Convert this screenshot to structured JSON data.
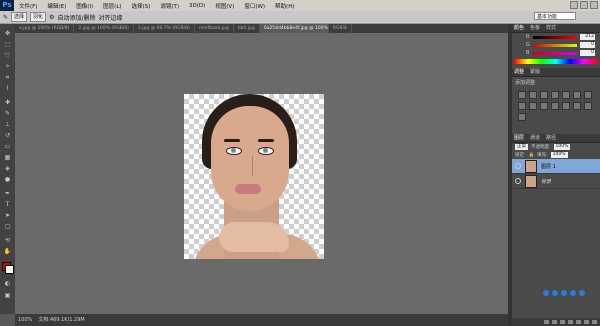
{
  "app": {
    "logo": "Ps",
    "workspace": "基本功能"
  },
  "menu": [
    "文件(F)",
    "编辑(E)",
    "图像(I)",
    "图层(L)",
    "选择(S)",
    "滤镜(T)",
    "3D(D)",
    "视图(V)",
    "窗口(W)",
    "帮助(H)"
  ],
  "options": {
    "mode": "选择",
    "feather": "羽化",
    "auto": "自动添加/删除",
    "align": "对齐边缘"
  },
  "tabs": [
    {
      "label": "a.jpg @ 100% (RGB/8)"
    },
    {
      "label": "2.jpg @ 100% (RGB/8)"
    },
    {
      "label": "3.jpg @ 66.7% (RGB/8)"
    },
    {
      "label": "mmfbaab.jpg"
    },
    {
      "label": "bb5.jpg"
    },
    {
      "label": "0a254d4bb8e4f.jpg @ 100% (图层 1, RGB/8)"
    },
    {
      "label": "RGB/8"
    }
  ],
  "colors": {
    "foreground": "#e00000",
    "background": "#ffffff",
    "layer_selected": "#7fa7d8"
  },
  "color_panel": {
    "tabs": [
      "颜色",
      "色板",
      "样式"
    ],
    "sliders": [
      {
        "label": "R",
        "value": "212"
      },
      {
        "label": "G",
        "value": "0"
      },
      {
        "label": "B",
        "value": "0"
      }
    ]
  },
  "adjust_panel": {
    "tabs": [
      "调整",
      "蒙版"
    ],
    "title": "添加调整"
  },
  "layers_panel": {
    "tabs": [
      "图层",
      "通道",
      "路径"
    ],
    "blend": "正常",
    "opacity_label": "不透明度:",
    "opacity": "100%",
    "lock_label": "锁定:",
    "fill_label": "填充:",
    "fill": "100%",
    "layers": [
      {
        "name": "图层 1",
        "selected": true
      },
      {
        "name": "背景",
        "selected": false
      }
    ]
  },
  "status": {
    "zoom": "100%",
    "doc": "文档:469.1K/1.29M"
  }
}
